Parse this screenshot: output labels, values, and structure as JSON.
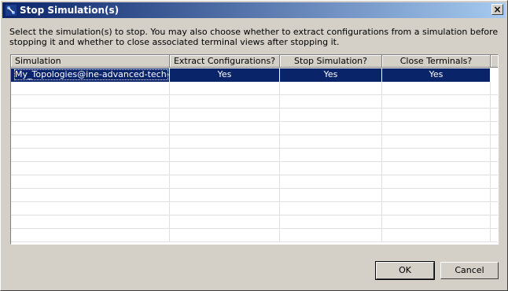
{
  "window": {
    "title": "Stop Simulation(s)",
    "close_glyph": "×",
    "icon": "app-icon"
  },
  "description": "Select the simulation(s) to stop.  You may also choose whether to extract configurations from a simulation before stopping it and whether to close associated terminal views after stopping it.",
  "table": {
    "columns": [
      "Simulation",
      "Extract Configurations?",
      "Stop Simulation?",
      "Close Terminals?"
    ],
    "rows": [
      [
        "My_Topologies@ine-advanced-tech-l...",
        "Yes",
        "Yes",
        "Yes"
      ]
    ],
    "selected_row": 0
  },
  "buttons": {
    "ok": "OK",
    "cancel": "Cancel"
  }
}
